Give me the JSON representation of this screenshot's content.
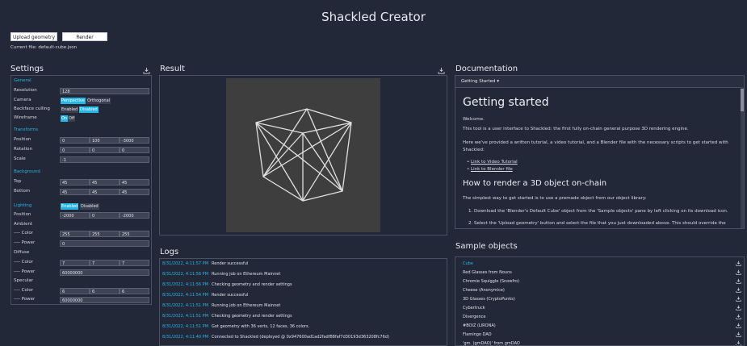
{
  "app": {
    "title": "Shackled Creator"
  },
  "toolbar": {
    "upload_label": "Upload geometry",
    "render_label": "Render",
    "current_file": "Current file: default-cube.json"
  },
  "settings": {
    "title": "Settings",
    "general": {
      "heading": "General",
      "resolution_label": "Resolution",
      "resolution_value": "128",
      "camera_label": "Camera",
      "camera_options": [
        "Perspective",
        "Orthogonal"
      ],
      "camera_selected": "Perspective",
      "backface_label": "Backface culling",
      "backface_options": [
        "Enabled",
        "Disabled"
      ],
      "backface_selected": "Disabled",
      "wireframe_label": "Wireframe",
      "wireframe_options": [
        "On",
        "Off"
      ],
      "wireframe_selected": "On"
    },
    "transforms": {
      "heading": "Transforms",
      "position_label": "Position",
      "position": [
        "0",
        "100",
        "-3000"
      ],
      "rotation_label": "Rotation",
      "rotation": [
        "0",
        "0",
        "0"
      ],
      "scale_label": "Scale",
      "scale": "-1"
    },
    "background": {
      "heading": "Background",
      "top_label": "Top",
      "top": [
        "45",
        "45",
        "45"
      ],
      "bottom_label": "Bottom",
      "bottom": [
        "45",
        "45",
        "45"
      ]
    },
    "lighting": {
      "heading": "Lighting",
      "options": [
        "Enabled",
        "Disabled"
      ],
      "selected": "Enabled",
      "position_label": "Position",
      "position": [
        "-2000",
        "0",
        "-2000"
      ],
      "ambient_label": "Ambient",
      "ambient_color_label": "---- Color",
      "ambient_color": [
        "255",
        "255",
        "255"
      ],
      "ambient_power_label": "---- Power",
      "ambient_power": "0",
      "diffuse_label": "Diffuse",
      "diffuse_color_label": "---- Color",
      "diffuse_color": [
        "7",
        "7",
        "7"
      ],
      "diffuse_power_label": "---- Power",
      "diffuse_power": "60000000",
      "specular_label": "Specular",
      "specular_color_label": "---- Color",
      "specular_color": [
        "6",
        "6",
        "6"
      ],
      "specular_power_label": "---- Power",
      "specular_power": "60000000"
    }
  },
  "result": {
    "title": "Result"
  },
  "logs": {
    "title": "Logs",
    "entries": [
      {
        "ts": "8/31/2022, 4:11:57 PM",
        "msg": "Render successful"
      },
      {
        "ts": "8/31/2022, 4:11:56 PM",
        "msg": "Running job on Ethereum Mainnet"
      },
      {
        "ts": "8/31/2022, 4:11:56 PM",
        "msg": "Checking geometry and render settings"
      },
      {
        "ts": "8/31/2022, 4:11:54 PM",
        "msg": "Render successful"
      },
      {
        "ts": "8/31/2022, 4:11:51 PM",
        "msg": "Running job on Ethereum Mainnet"
      },
      {
        "ts": "8/31/2022, 4:11:51 PM",
        "msg": "Checking geometry and render settings"
      },
      {
        "ts": "8/31/2022, 4:11:51 PM",
        "msg": "Got geometry with 36 verts, 12 faces, 36 colors."
      },
      {
        "ts": "8/31/2022, 4:11:40 PM",
        "msg": "Connected to Shackled (deployed @ 0x947600ad1ad2fadf88faf7d30193d363208fc76d)"
      }
    ]
  },
  "documentation": {
    "title": "Documentation",
    "dropdown": "Getting Started ▾",
    "heading": "Getting started",
    "p_welcome": "Welcome.",
    "p_intro": "This tool is a user interface to Shackled: the first fully on-chain general purpose 3D rendering engine.",
    "p_provided_1": "Here we've provided a written tutorial, a video tutorial, and a Blender file with the necessary scripts to get started with",
    "p_provided_2": "Shackled:",
    "link_video": "Link to Video Tutorial",
    "link_blender": "Link to Blender file",
    "subheading": "How to render a 3D object on-chain",
    "p_simplest": "The simplest way to get started is to use a premade object from our object library:",
    "step1": "1. Download the 'Blender's Default Cube' object from the 'Sample objects' pane by left clicking on its download icon.",
    "step2": "2. Select the 'Upload geometry' button and select the file that you just downloaded above. This should override the"
  },
  "samples": {
    "title": "Sample objects",
    "items": [
      "Cube",
      "Red Glasses from Nouns",
      "Chromie Squiggle (Snowfro)",
      "Cheese (Anonymice)",
      "3D Glasses (CryptoPunks)",
      "Cybertruck",
      "Divergence",
      "#BOIZ (LIRONA)",
      "Flamingo DAO",
      "'gm. (gmDAO)' from gmDAO"
    ],
    "active": "Cube"
  },
  "colors": {
    "background": "#232838",
    "accent": "#25b6e6",
    "border": "#4a5063",
    "canvas": "#3e3e3e"
  },
  "icons": {
    "download": "download-icon"
  }
}
